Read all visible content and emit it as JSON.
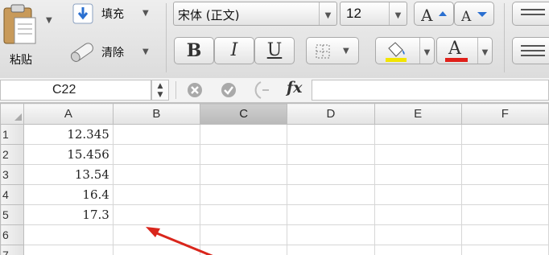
{
  "clipboard": {
    "paste_label": "粘贴"
  },
  "fill": {
    "fill_label": "填充",
    "clear_label": "清除"
  },
  "font": {
    "family_value": "宋体 (正文)",
    "size_value": "12",
    "bold": "B",
    "italic": "I",
    "underline": "U",
    "highlight_color": "#f2e500",
    "font_color": "#e0201a",
    "font_color_letter": "A"
  },
  "formula_bar": {
    "name_box": "C22",
    "fx_label": "fx"
  },
  "sheet": {
    "columns": [
      "A",
      "B",
      "C",
      "D",
      "E",
      "F"
    ],
    "selected_column": "C",
    "rows": [
      {
        "num": "1",
        "a": "12.345"
      },
      {
        "num": "2",
        "a": "15.456"
      },
      {
        "num": "3",
        "a": "13.54"
      },
      {
        "num": "4",
        "a": "16.4"
      },
      {
        "num": "5",
        "a": "17.3"
      },
      {
        "num": "6",
        "a": ""
      },
      {
        "num": "7",
        "a": ""
      }
    ]
  },
  "annotation": {
    "arrow_color": "#d9261c"
  }
}
